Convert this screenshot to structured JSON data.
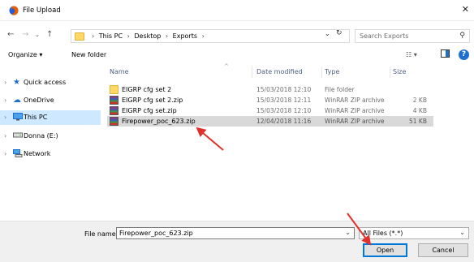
{
  "window": {
    "title": "File Upload",
    "close_glyph": "✕"
  },
  "address": {
    "breadcrumbs": [
      "This PC",
      "Desktop",
      "Exports"
    ],
    "separator": "›",
    "search_placeholder": "Search Exports"
  },
  "toolbar": {
    "organize": "Organize ▾",
    "new_folder": "New folder"
  },
  "nav": {
    "items": [
      {
        "label": "Quick access",
        "icon": "star-icon"
      },
      {
        "label": "OneDrive",
        "icon": "cloud-icon"
      },
      {
        "label": "This PC",
        "icon": "computer-icon",
        "selected": true
      },
      {
        "label": "Donna (E:)",
        "icon": "drive-icon"
      },
      {
        "label": "Network",
        "icon": "network-icon"
      }
    ]
  },
  "columns": {
    "name": "Name",
    "date": "Date modified",
    "type": "Type",
    "size": "Size"
  },
  "files": [
    {
      "name": "EIGRP cfg set 2",
      "date": "15/03/2018 12:10",
      "type": "File folder",
      "size": "",
      "icon": "folder-icon"
    },
    {
      "name": "EIGRP cfg set 2.zip",
      "date": "15/03/2018 12:11",
      "type": "WinRAR ZIP archive",
      "size": "2 KB",
      "icon": "zip-icon"
    },
    {
      "name": "EIGRP cfg set.zip",
      "date": "15/03/2018 12:10",
      "type": "WinRAR ZIP archive",
      "size": "4 KB",
      "icon": "zip-icon"
    },
    {
      "name": "Firepower_poc_623.zip",
      "date": "12/04/2018 11:16",
      "type": "WinRAR ZIP archive",
      "size": "51 KB",
      "icon": "zip-icon",
      "selected": true
    }
  ],
  "bottom": {
    "filename_label": "File name:",
    "filename_value": "Firepower_poc_623.zip",
    "filetype_value": "All Files (*.*)",
    "open_label": "Open",
    "cancel_label": "Cancel"
  },
  "colors": {
    "selection": "#cde8ff",
    "row_selected": "#d9d9d9",
    "accent": "#0078d7",
    "annotation_arrow": "#e0312b"
  }
}
